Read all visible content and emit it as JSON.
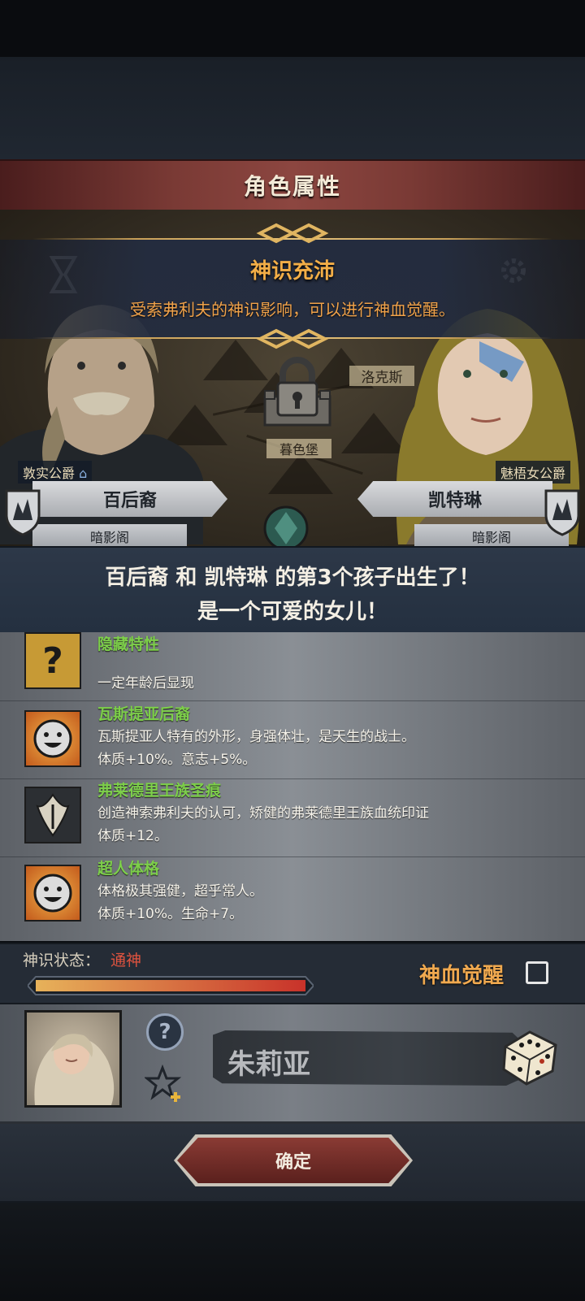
{
  "header": {
    "title": "角色属性"
  },
  "event": {
    "title": "神识充沛",
    "description": "受索弗利夫的神识影响，可以进行神血觉醒。"
  },
  "map": {
    "castle": "暮色堡",
    "city": "洛克斯"
  },
  "father": {
    "title": "敦实公爵",
    "name": "百后裔",
    "house": "暗影阁"
  },
  "mother": {
    "title": "魅梧女公爵",
    "name": "凯特琳",
    "house": "暗影阁"
  },
  "announcement": {
    "line1": "百后裔 和 凯特琳 的第3个孩子出生了！",
    "line2": "是一个可爱的女儿！"
  },
  "traits": [
    {
      "name": "隐藏特性",
      "desc1": "",
      "desc2": "一定年龄后显现",
      "icon": "question-icon"
    },
    {
      "name": "瓦斯提亚后裔",
      "desc1": "瓦斯提亚人特有的外形，身强体壮，是天生的战士。",
      "desc2": "体质+10%。意志+5%。",
      "icon": "smile-face-icon"
    },
    {
      "name": "弗莱德里王族圣痕",
      "desc1": "创造神索弗利夫的认可，矫健的弗莱德里王族血统印证",
      "desc2": "体质+12。",
      "icon": "royal-crest-icon"
    },
    {
      "name": "超人体格",
      "desc1": "体格极其强健，超乎常人。",
      "desc2": "体质+10%。生命+7。",
      "icon": "smile-face-icon"
    }
  ],
  "status": {
    "label": "神识状态：",
    "value": "通神",
    "progress": 1.0,
    "awaken_label": "神血觉醒",
    "awaken_checked": false
  },
  "child": {
    "name": "朱莉亚"
  },
  "footer": {
    "confirm_label": "确定"
  },
  "colors": {
    "trait_name": "#7dcf4a",
    "event_title": "#f3ae47",
    "status_value": "#e0533f"
  }
}
